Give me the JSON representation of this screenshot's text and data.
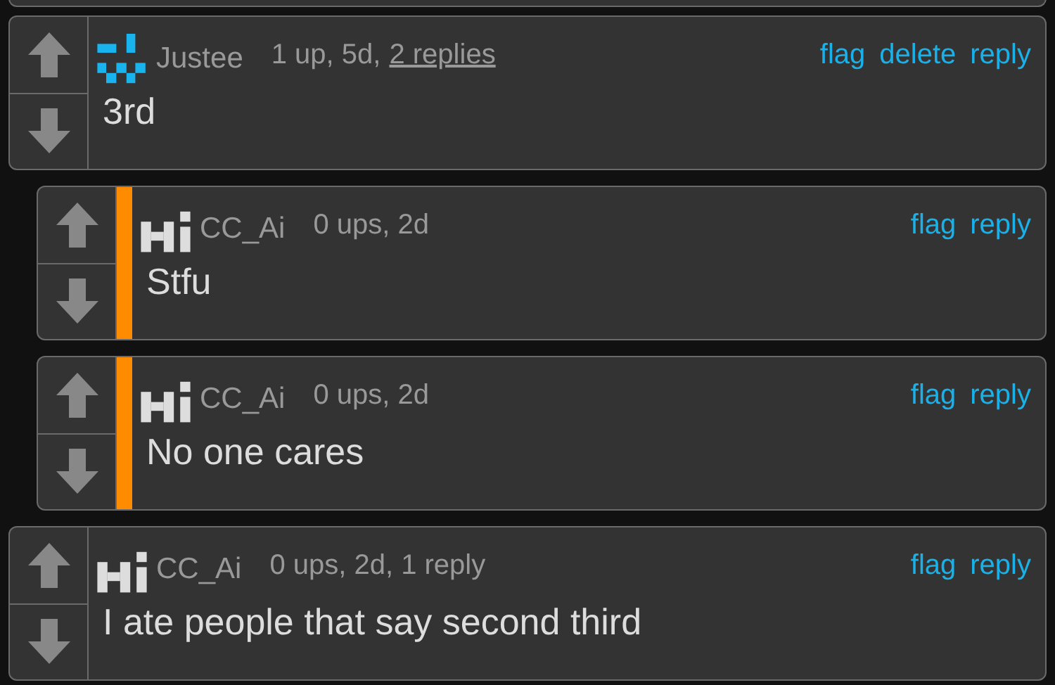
{
  "comments": [
    {
      "avatar": {
        "kind": "dots"
      },
      "author": "Justee",
      "meta": "1 up, 5d,",
      "replies_link": "2 replies",
      "actions": [
        "flag",
        "delete",
        "reply"
      ],
      "text": "3rd",
      "new": false,
      "children": [
        {
          "avatar": {
            "kind": "hi"
          },
          "author": "CC_Ai",
          "meta": "0 ups, 2d",
          "actions": [
            "flag",
            "reply"
          ],
          "text": "Stfu",
          "new": true
        },
        {
          "avatar": {
            "kind": "hi"
          },
          "author": "CC_Ai",
          "meta": "0 ups, 2d",
          "actions": [
            "flag",
            "reply"
          ],
          "text": "No one cares",
          "new": true
        }
      ]
    },
    {
      "avatar": {
        "kind": "hi"
      },
      "author": "CC_Ai",
      "meta": "0 ups, 2d, 1 reply",
      "actions": [
        "flag",
        "reply"
      ],
      "text": "I ate people that say second third",
      "new": false
    }
  ]
}
